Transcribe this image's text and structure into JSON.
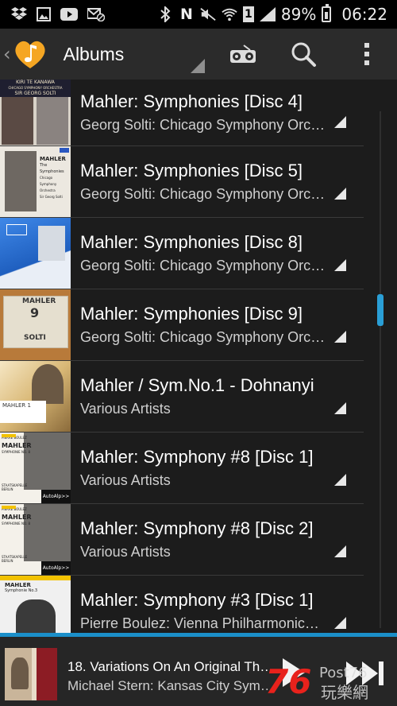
{
  "status_bar": {
    "battery": "89%",
    "time": "06:22",
    "icons_left": [
      "dropbox-icon",
      "image-icon",
      "youtube-icon",
      "mail-blocked-icon"
    ],
    "icons_right": [
      "bluetooth-icon",
      "nfc-icon",
      "mute-icon",
      "wifi-icon",
      "sim-icon",
      "signal-icon",
      "battery-icon"
    ],
    "sim_number": "1",
    "nfc_letter": "N"
  },
  "action_bar": {
    "title": "Albums",
    "actions": [
      "radio-icon",
      "search-icon",
      "overflow-menu-icon"
    ],
    "accent": "#f0a028"
  },
  "albums": [
    {
      "title": "Mahler: Symphonies [Disc 4]",
      "artist": "Georg Solti: Chicago Symphony Orc…",
      "cover_text": [
        "KIRI TE KANAWA",
        "CHICAGO SYMPHONY ORCHESTRA",
        "SIR GEORG SOLTI"
      ]
    },
    {
      "title": "Mahler: Symphonies [Disc 5]",
      "artist": "Georg Solti: Chicago Symphony Orc…",
      "cover_text": [
        "MAHLER",
        "The Symphonies",
        "Chicago Symphony Orchestra",
        "Sir Georg Solti"
      ]
    },
    {
      "title": "Mahler: Symphonies [Disc 8]",
      "artist": "Georg Solti: Chicago Symphony Orc…",
      "cover_text": []
    },
    {
      "title": "Mahler: Symphonies [Disc 9]",
      "artist": "Georg Solti: Chicago Symphony Orc…",
      "cover_text": [
        "MAHLER",
        "9",
        "SOLTI"
      ]
    },
    {
      "title": "Mahler / Sym.No.1 - Dohnanyi",
      "artist": "Various Artists",
      "cover_text": [
        "MAHLER 1"
      ]
    },
    {
      "title": "Mahler: Symphony #8 [Disc 1]",
      "artist": "Various Artists",
      "cover_text": [
        "PIERRE BOULEZ",
        "MAHLER",
        "SYMPHONIE NO. 8",
        "STAATSKAPELLE BERLIN",
        "AutoAlp>>"
      ]
    },
    {
      "title": "Mahler: Symphony #8 [Disc 2]",
      "artist": "Various Artists",
      "cover_text": [
        "PIERRE BOULEZ",
        "MAHLER",
        "SYMPHONIE NO. 8",
        "STAATSKAPELLE BERLIN",
        "AutoAlp>>"
      ]
    },
    {
      "title": "Mahler: Symphony #3 [Disc 1]",
      "artist": "Pierre Boulez: Vienna Philharmonic…",
      "cover_text": [
        "MAHLER",
        "Symphonie No.3"
      ]
    }
  ],
  "now_playing": {
    "title": "18. Variations On An Original Th…",
    "artist": "Michael Stern: Kansas City Sym…",
    "controls": [
      "play-icon",
      "next-icon"
    ]
  },
  "watermark": {
    "brand": "76",
    "text": "Post76",
    "chinese": "玩樂網"
  },
  "colors": {
    "accent": "#1b8fc9",
    "background": "#1c1c1c",
    "actionbar": "#2b2b2b"
  }
}
